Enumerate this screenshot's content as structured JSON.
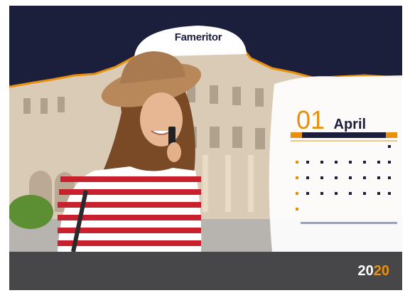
{
  "brand": {
    "title": "Fameritor",
    "subtitle": ""
  },
  "calendar": {
    "day": "01",
    "month": "April",
    "weekday_headers": [
      "",
      "",
      "",
      "",
      "",
      "",
      ""
    ],
    "accent_color": "#e8900e"
  },
  "footer": {
    "year_a": "20",
    "year_b": "20",
    "tagline": ""
  },
  "colors": {
    "navy": "#1b1f3b",
    "orange": "#e8900e",
    "shirt_red": "#c8202c",
    "hat_tan": "#b8875a"
  }
}
